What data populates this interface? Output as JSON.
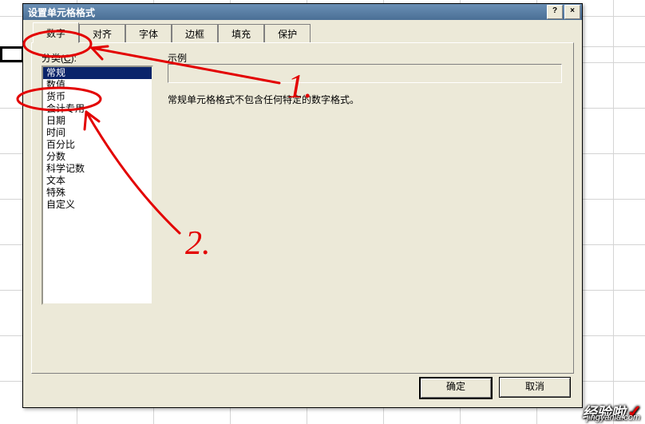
{
  "dialog": {
    "title": "设置单元格格式",
    "help_btn": "?",
    "close_btn": "×"
  },
  "tabs": [
    {
      "label": "数字",
      "active": true
    },
    {
      "label": "对齐",
      "active": false
    },
    {
      "label": "字体",
      "active": false
    },
    {
      "label": "边框",
      "active": false
    },
    {
      "label": "填充",
      "active": false
    },
    {
      "label": "保护",
      "active": false
    }
  ],
  "category": {
    "label_prefix": "分类(",
    "hotkey": "C",
    "label_suffix": "):",
    "items": [
      "常规",
      "数值",
      "货币",
      "会计专用",
      "日期",
      "时间",
      "百分比",
      "分数",
      "科学记数",
      "文本",
      "特殊",
      "自定义"
    ],
    "selected_index": 0
  },
  "example": {
    "label": "示例",
    "value": ""
  },
  "description": "常规单元格格式不包含任何特定的数字格式。",
  "buttons": {
    "ok": "确定",
    "cancel": "取消"
  },
  "annotations": {
    "num1": "1.",
    "num2": "2.",
    "stroke_color": "#e30000"
  },
  "watermark": {
    "main": "经验啦",
    "sub": "jingyanla",
    "dom": ".com",
    "check": "✓"
  }
}
